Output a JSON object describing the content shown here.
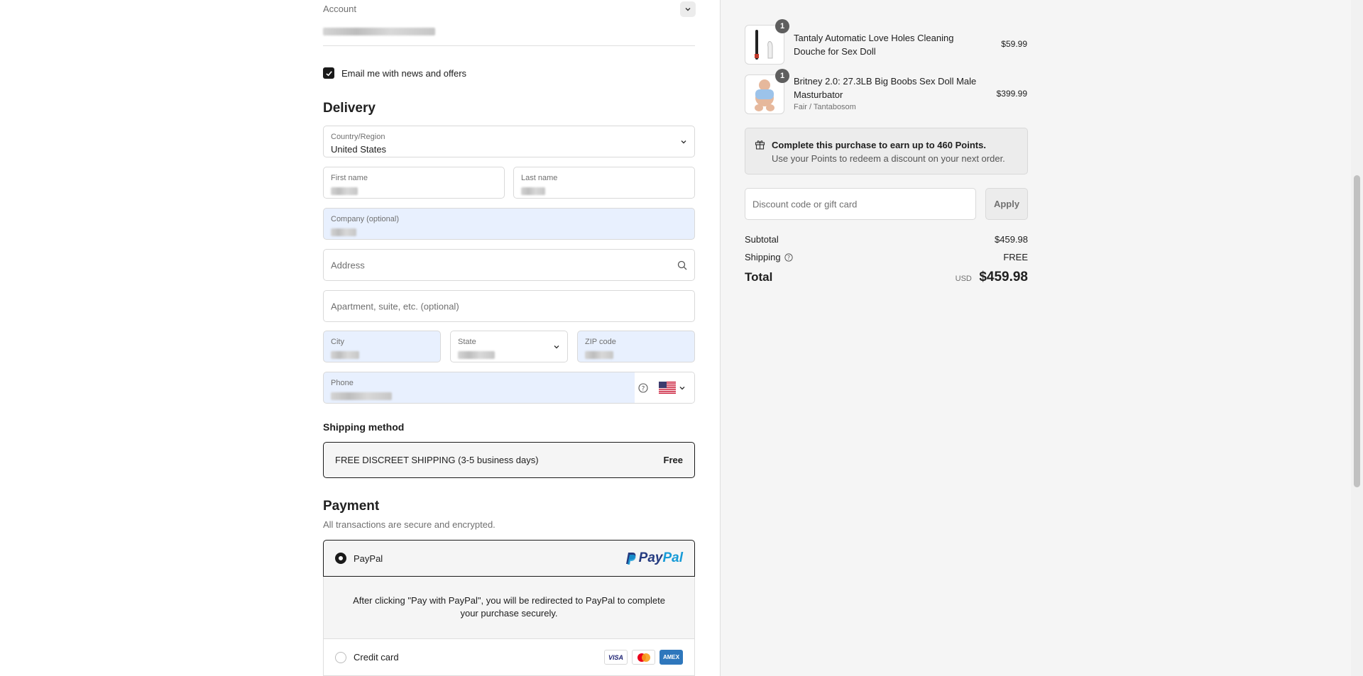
{
  "account": {
    "label": "Account"
  },
  "marketing": {
    "label": "Email me with news and offers",
    "checked": true
  },
  "delivery": {
    "heading": "Delivery",
    "country": {
      "label": "Country/Region",
      "value": "United States"
    },
    "first_name": {
      "label": "First name"
    },
    "last_name": {
      "label": "Last name"
    },
    "company": {
      "label": "Company (optional)"
    },
    "address": {
      "placeholder": "Address"
    },
    "apartment": {
      "placeholder": "Apartment, suite, etc. (optional)"
    },
    "city": {
      "label": "City"
    },
    "state": {
      "label": "State"
    },
    "zip": {
      "label": "ZIP code"
    },
    "phone": {
      "label": "Phone"
    }
  },
  "shipping": {
    "heading": "Shipping method",
    "option_label": "FREE DISCREET SHIPPING (3-5 business days)",
    "option_price": "Free"
  },
  "payment": {
    "heading": "Payment",
    "subtitle": "All transactions are secure and encrypted.",
    "paypal_label": "PayPal",
    "paypal_logo_a": "Pay",
    "paypal_logo_b": "Pal",
    "paypal_note": "After clicking \"Pay with PayPal\", you will be redirected to PayPal to complete your purchase securely.",
    "credit_label": "Credit card",
    "cards": [
      "VISA",
      "MC",
      "AMEX"
    ]
  },
  "cart": {
    "items": [
      {
        "qty": "1",
        "name": "Tantaly Automatic Love Holes Cleaning Douche for Sex Doll",
        "variant": "",
        "price": "$59.99"
      },
      {
        "qty": "1",
        "name": "Britney 2.0: 27.3LB Big Boobs Sex Doll Male Masturbator",
        "variant": "Fair / Tantabosom",
        "price": "$399.99"
      }
    ],
    "points_title": "Complete this purchase to earn up to 460 Points.",
    "points_sub": "Use your Points to redeem a discount on your next order.",
    "discount_placeholder": "Discount code or gift card",
    "apply_label": "Apply",
    "subtotal_label": "Subtotal",
    "subtotal_value": "$459.98",
    "shipping_label": "Shipping",
    "shipping_value": "FREE",
    "total_label": "Total",
    "currency": "USD",
    "total_value": "$459.98"
  }
}
